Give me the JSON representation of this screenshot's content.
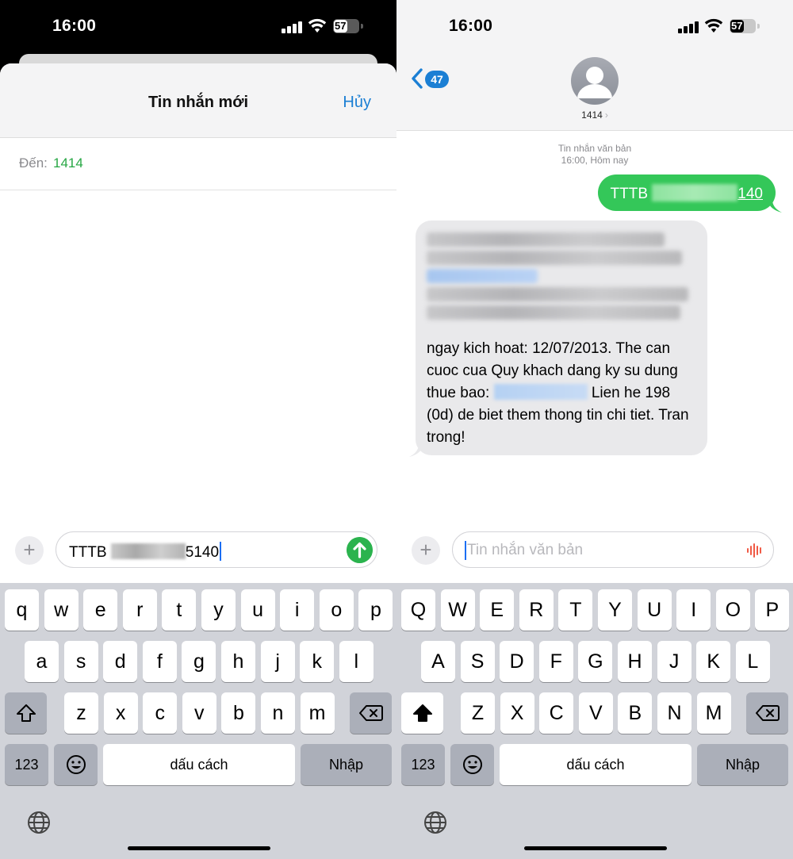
{
  "left": {
    "status": {
      "time": "16:00",
      "battery": "57"
    },
    "header": {
      "title": "Tin nhắn mới",
      "cancel": "Hủy"
    },
    "to": {
      "label": "Đến:",
      "value": "1414"
    },
    "input": {
      "prefix": "TTTB",
      "suffix": "5140"
    },
    "keyboard": {
      "row1": [
        "q",
        "w",
        "e",
        "r",
        "t",
        "y",
        "u",
        "i",
        "o",
        "p"
      ],
      "row2": [
        "a",
        "s",
        "d",
        "f",
        "g",
        "h",
        "j",
        "k",
        "l"
      ],
      "row3": [
        "z",
        "x",
        "c",
        "v",
        "b",
        "n",
        "m"
      ],
      "numbers": "123",
      "space": "dấu cách",
      "return": "Nhập"
    }
  },
  "right": {
    "status": {
      "time": "16:00",
      "battery": "57"
    },
    "header": {
      "back_count": "47",
      "contact": "1414"
    },
    "meta": {
      "line1": "Tin nhắn văn bản",
      "line2": "16:00, Hôm nay"
    },
    "outgoing": {
      "prefix": "TTTB",
      "suffix": "140"
    },
    "incoming": {
      "visible_text": "ngay kich hoat: 12/07/2013. The can cuoc cua Quy khach dang ky su dung thue bao:",
      "visible_text_end": "Lien he 198 (0d) de biet them thong tin chi tiet. Tran trong!"
    },
    "input": {
      "placeholder": "Tin nhắn văn bản"
    },
    "keyboard": {
      "row1": [
        "Q",
        "W",
        "E",
        "R",
        "T",
        "Y",
        "U",
        "I",
        "O",
        "P"
      ],
      "row2": [
        "A",
        "S",
        "D",
        "F",
        "G",
        "H",
        "J",
        "K",
        "L"
      ],
      "row3": [
        "Z",
        "X",
        "C",
        "V",
        "B",
        "N",
        "M"
      ],
      "numbers": "123",
      "space": "dấu cách",
      "return": "Nhập"
    }
  },
  "colors": {
    "accent_blue": "#1b7fd4",
    "imessage_green": "#34c759",
    "link_green": "#27a744"
  },
  "icons": [
    "signal-icon",
    "wifi-icon",
    "battery-icon",
    "plus-icon",
    "send-icon",
    "back-chevron-icon",
    "avatar-icon",
    "audio-wave-icon",
    "shift-icon",
    "delete-icon",
    "emoji-icon",
    "globe-icon"
  ]
}
